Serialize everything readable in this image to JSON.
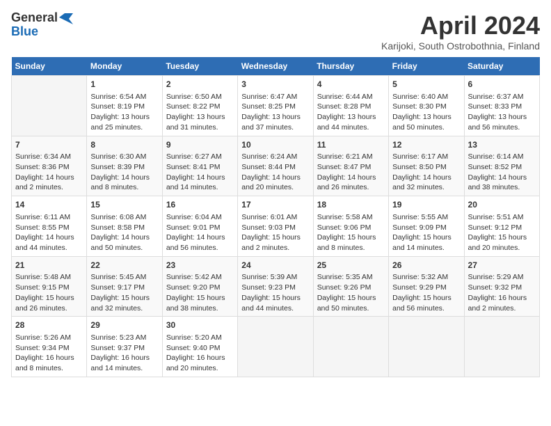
{
  "header": {
    "logo_general": "General",
    "logo_blue": "Blue",
    "month": "April 2024",
    "location": "Karijoki, South Ostrobothnia, Finland"
  },
  "weekdays": [
    "Sunday",
    "Monday",
    "Tuesday",
    "Wednesday",
    "Thursday",
    "Friday",
    "Saturday"
  ],
  "weeks": [
    [
      {
        "day": "",
        "info": ""
      },
      {
        "day": "1",
        "info": "Sunrise: 6:54 AM\nSunset: 8:19 PM\nDaylight: 13 hours\nand 25 minutes."
      },
      {
        "day": "2",
        "info": "Sunrise: 6:50 AM\nSunset: 8:22 PM\nDaylight: 13 hours\nand 31 minutes."
      },
      {
        "day": "3",
        "info": "Sunrise: 6:47 AM\nSunset: 8:25 PM\nDaylight: 13 hours\nand 37 minutes."
      },
      {
        "day": "4",
        "info": "Sunrise: 6:44 AM\nSunset: 8:28 PM\nDaylight: 13 hours\nand 44 minutes."
      },
      {
        "day": "5",
        "info": "Sunrise: 6:40 AM\nSunset: 8:30 PM\nDaylight: 13 hours\nand 50 minutes."
      },
      {
        "day": "6",
        "info": "Sunrise: 6:37 AM\nSunset: 8:33 PM\nDaylight: 13 hours\nand 56 minutes."
      }
    ],
    [
      {
        "day": "7",
        "info": "Sunrise: 6:34 AM\nSunset: 8:36 PM\nDaylight: 14 hours\nand 2 minutes."
      },
      {
        "day": "8",
        "info": "Sunrise: 6:30 AM\nSunset: 8:39 PM\nDaylight: 14 hours\nand 8 minutes."
      },
      {
        "day": "9",
        "info": "Sunrise: 6:27 AM\nSunset: 8:41 PM\nDaylight: 14 hours\nand 14 minutes."
      },
      {
        "day": "10",
        "info": "Sunrise: 6:24 AM\nSunset: 8:44 PM\nDaylight: 14 hours\nand 20 minutes."
      },
      {
        "day": "11",
        "info": "Sunrise: 6:21 AM\nSunset: 8:47 PM\nDaylight: 14 hours\nand 26 minutes."
      },
      {
        "day": "12",
        "info": "Sunrise: 6:17 AM\nSunset: 8:50 PM\nDaylight: 14 hours\nand 32 minutes."
      },
      {
        "day": "13",
        "info": "Sunrise: 6:14 AM\nSunset: 8:52 PM\nDaylight: 14 hours\nand 38 minutes."
      }
    ],
    [
      {
        "day": "14",
        "info": "Sunrise: 6:11 AM\nSunset: 8:55 PM\nDaylight: 14 hours\nand 44 minutes."
      },
      {
        "day": "15",
        "info": "Sunrise: 6:08 AM\nSunset: 8:58 PM\nDaylight: 14 hours\nand 50 minutes."
      },
      {
        "day": "16",
        "info": "Sunrise: 6:04 AM\nSunset: 9:01 PM\nDaylight: 14 hours\nand 56 minutes."
      },
      {
        "day": "17",
        "info": "Sunrise: 6:01 AM\nSunset: 9:03 PM\nDaylight: 15 hours\nand 2 minutes."
      },
      {
        "day": "18",
        "info": "Sunrise: 5:58 AM\nSunset: 9:06 PM\nDaylight: 15 hours\nand 8 minutes."
      },
      {
        "day": "19",
        "info": "Sunrise: 5:55 AM\nSunset: 9:09 PM\nDaylight: 15 hours\nand 14 minutes."
      },
      {
        "day": "20",
        "info": "Sunrise: 5:51 AM\nSunset: 9:12 PM\nDaylight: 15 hours\nand 20 minutes."
      }
    ],
    [
      {
        "day": "21",
        "info": "Sunrise: 5:48 AM\nSunset: 9:15 PM\nDaylight: 15 hours\nand 26 minutes."
      },
      {
        "day": "22",
        "info": "Sunrise: 5:45 AM\nSunset: 9:17 PM\nDaylight: 15 hours\nand 32 minutes."
      },
      {
        "day": "23",
        "info": "Sunrise: 5:42 AM\nSunset: 9:20 PM\nDaylight: 15 hours\nand 38 minutes."
      },
      {
        "day": "24",
        "info": "Sunrise: 5:39 AM\nSunset: 9:23 PM\nDaylight: 15 hours\nand 44 minutes."
      },
      {
        "day": "25",
        "info": "Sunrise: 5:35 AM\nSunset: 9:26 PM\nDaylight: 15 hours\nand 50 minutes."
      },
      {
        "day": "26",
        "info": "Sunrise: 5:32 AM\nSunset: 9:29 PM\nDaylight: 15 hours\nand 56 minutes."
      },
      {
        "day": "27",
        "info": "Sunrise: 5:29 AM\nSunset: 9:32 PM\nDaylight: 16 hours\nand 2 minutes."
      }
    ],
    [
      {
        "day": "28",
        "info": "Sunrise: 5:26 AM\nSunset: 9:34 PM\nDaylight: 16 hours\nand 8 minutes."
      },
      {
        "day": "29",
        "info": "Sunrise: 5:23 AM\nSunset: 9:37 PM\nDaylight: 16 hours\nand 14 minutes."
      },
      {
        "day": "30",
        "info": "Sunrise: 5:20 AM\nSunset: 9:40 PM\nDaylight: 16 hours\nand 20 minutes."
      },
      {
        "day": "",
        "info": ""
      },
      {
        "day": "",
        "info": ""
      },
      {
        "day": "",
        "info": ""
      },
      {
        "day": "",
        "info": ""
      }
    ]
  ]
}
